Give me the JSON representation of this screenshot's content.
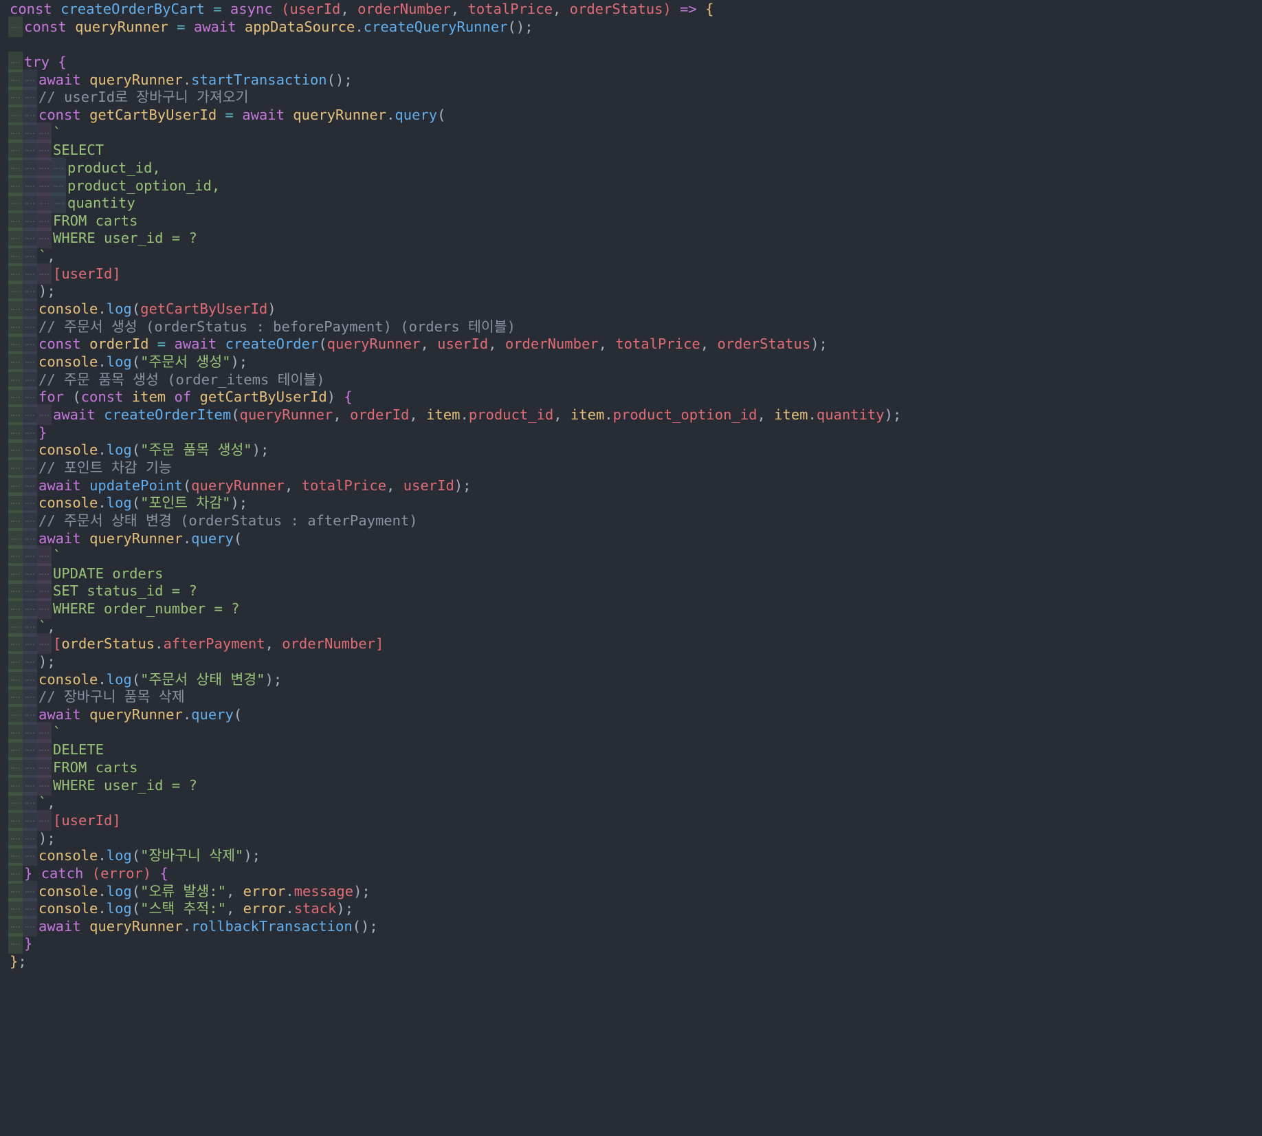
{
  "lines": [
    {
      "indent": 0,
      "tokens": [
        [
          "k",
          "const "
        ],
        [
          "f",
          "createOrderByCart"
        ],
        [
          "o",
          " = "
        ],
        [
          "k",
          "async "
        ],
        [
          "p",
          "("
        ],
        [
          "p",
          "userId"
        ],
        [
          "t",
          ", "
        ],
        [
          "p",
          "orderNumber"
        ],
        [
          "t",
          ", "
        ],
        [
          "p",
          "totalPrice"
        ],
        [
          "t",
          ", "
        ],
        [
          "p",
          "orderStatus"
        ],
        [
          "p",
          ")"
        ],
        [
          "k",
          " => "
        ],
        [
          "v",
          "{"
        ]
      ]
    },
    {
      "indent": 1,
      "tokens": [
        [
          "k",
          "const "
        ],
        [
          "v",
          "queryRunner"
        ],
        [
          "o",
          " = "
        ],
        [
          "k",
          "await "
        ],
        [
          "v",
          "appDataSource"
        ],
        [
          "t",
          "."
        ],
        [
          "f",
          "createQueryRunner"
        ],
        [
          "t",
          "();"
        ]
      ]
    },
    {
      "indent": 0,
      "tokens": []
    },
    {
      "indent": 1,
      "tokens": [
        [
          "k",
          "try "
        ],
        [
          "k",
          "{"
        ]
      ]
    },
    {
      "indent": 2,
      "tokens": [
        [
          "k",
          "await "
        ],
        [
          "v",
          "queryRunner"
        ],
        [
          "t",
          "."
        ],
        [
          "f",
          "startTransaction"
        ],
        [
          "t",
          "();"
        ]
      ]
    },
    {
      "indent": 2,
      "tokens": [
        [
          "c",
          "// userId로 장바구니 가져오기"
        ]
      ]
    },
    {
      "indent": 2,
      "tokens": [
        [
          "k",
          "const "
        ],
        [
          "v",
          "getCartByUserId"
        ],
        [
          "o",
          " = "
        ],
        [
          "k",
          "await "
        ],
        [
          "v",
          "queryRunner"
        ],
        [
          "t",
          "."
        ],
        [
          "f",
          "query"
        ],
        [
          "t",
          "("
        ]
      ]
    },
    {
      "indent": 3,
      "tokens": [
        [
          "s",
          "`"
        ]
      ]
    },
    {
      "indent": 3,
      "tokens": [
        [
          "s",
          "SELECT"
        ]
      ]
    },
    {
      "indent": 4,
      "tokens": [
        [
          "s",
          "product_id,"
        ]
      ]
    },
    {
      "indent": 4,
      "tokens": [
        [
          "s",
          "product_option_id,"
        ]
      ]
    },
    {
      "indent": 4,
      "tokens": [
        [
          "s",
          "quantity"
        ]
      ]
    },
    {
      "indent": 3,
      "tokens": [
        [
          "s",
          "FROM carts"
        ]
      ]
    },
    {
      "indent": 3,
      "tokens": [
        [
          "s",
          "WHERE user_id = ?"
        ]
      ]
    },
    {
      "indent": 2,
      "tokens": [
        [
          "s",
          "`"
        ],
        [
          "t",
          ","
        ]
      ]
    },
    {
      "indent": 3,
      "tokens": [
        [
          "p",
          "[userId]"
        ]
      ]
    },
    {
      "indent": 2,
      "tokens": [
        [
          "t",
          ");"
        ]
      ]
    },
    {
      "indent": 2,
      "tokens": [
        [
          "v",
          "console"
        ],
        [
          "t",
          "."
        ],
        [
          "f",
          "log"
        ],
        [
          "t",
          "("
        ],
        [
          "p",
          "getCartByUserId"
        ],
        [
          "t",
          ")"
        ]
      ]
    },
    {
      "indent": 2,
      "tokens": [
        [
          "c",
          "// 주문서 생성 (orderStatus : beforePayment) (orders 테이블)"
        ]
      ]
    },
    {
      "indent": 2,
      "tokens": [
        [
          "k",
          "const "
        ],
        [
          "v",
          "orderId"
        ],
        [
          "o",
          " = "
        ],
        [
          "k",
          "await "
        ],
        [
          "f",
          "createOrder"
        ],
        [
          "t",
          "("
        ],
        [
          "p",
          "queryRunner"
        ],
        [
          "t",
          ", "
        ],
        [
          "p",
          "userId"
        ],
        [
          "t",
          ", "
        ],
        [
          "p",
          "orderNumber"
        ],
        [
          "t",
          ", "
        ],
        [
          "p",
          "totalPrice"
        ],
        [
          "t",
          ", "
        ],
        [
          "p",
          "orderStatus"
        ],
        [
          "t",
          ");"
        ]
      ]
    },
    {
      "indent": 2,
      "tokens": [
        [
          "v",
          "console"
        ],
        [
          "t",
          "."
        ],
        [
          "f",
          "log"
        ],
        [
          "t",
          "("
        ],
        [
          "s",
          "\"주문서 생성\""
        ],
        [
          "t",
          ");"
        ]
      ]
    },
    {
      "indent": 2,
      "tokens": [
        [
          "c",
          "// 주문 품목 생성 (order_items 테이블)"
        ]
      ]
    },
    {
      "indent": 2,
      "tokens": [
        [
          "k",
          "for "
        ],
        [
          "t",
          "("
        ],
        [
          "k",
          "const "
        ],
        [
          "v",
          "item"
        ],
        [
          "k",
          " of "
        ],
        [
          "v",
          "getCartByUserId"
        ],
        [
          "t",
          ") "
        ],
        [
          "k",
          "{"
        ]
      ]
    },
    {
      "indent": 3,
      "tokens": [
        [
          "k",
          "await "
        ],
        [
          "f",
          "createOrderItem"
        ],
        [
          "t",
          "("
        ],
        [
          "p",
          "queryRunner"
        ],
        [
          "t",
          ", "
        ],
        [
          "p",
          "orderId"
        ],
        [
          "t",
          ", "
        ],
        [
          "v",
          "item"
        ],
        [
          "t",
          "."
        ],
        [
          "p",
          "product_id"
        ],
        [
          "t",
          ", "
        ],
        [
          "v",
          "item"
        ],
        [
          "t",
          "."
        ],
        [
          "p",
          "product_option_id"
        ],
        [
          "t",
          ", "
        ],
        [
          "v",
          "item"
        ],
        [
          "t",
          "."
        ],
        [
          "p",
          "quantity"
        ],
        [
          "t",
          ");"
        ]
      ]
    },
    {
      "indent": 2,
      "tokens": [
        [
          "k",
          "}"
        ]
      ]
    },
    {
      "indent": 2,
      "tokens": [
        [
          "v",
          "console"
        ],
        [
          "t",
          "."
        ],
        [
          "f",
          "log"
        ],
        [
          "t",
          "("
        ],
        [
          "s",
          "\"주문 품목 생성\""
        ],
        [
          "t",
          ");"
        ]
      ]
    },
    {
      "indent": 2,
      "tokens": [
        [
          "c",
          "// 포인트 차감 기능"
        ]
      ]
    },
    {
      "indent": 2,
      "tokens": [
        [
          "k",
          "await "
        ],
        [
          "f",
          "updatePoint"
        ],
        [
          "t",
          "("
        ],
        [
          "p",
          "queryRunner"
        ],
        [
          "t",
          ", "
        ],
        [
          "p",
          "totalPrice"
        ],
        [
          "t",
          ", "
        ],
        [
          "p",
          "userId"
        ],
        [
          "t",
          ");"
        ]
      ]
    },
    {
      "indent": 2,
      "tokens": [
        [
          "v",
          "console"
        ],
        [
          "t",
          "."
        ],
        [
          "f",
          "log"
        ],
        [
          "t",
          "("
        ],
        [
          "s",
          "\"포인트 차감\""
        ],
        [
          "t",
          ");"
        ]
      ]
    },
    {
      "indent": 2,
      "tokens": [
        [
          "c",
          "// 주문서 상태 변경 (orderStatus : afterPayment)"
        ]
      ]
    },
    {
      "indent": 2,
      "tokens": [
        [
          "k",
          "await "
        ],
        [
          "v",
          "queryRunner"
        ],
        [
          "t",
          "."
        ],
        [
          "f",
          "query"
        ],
        [
          "t",
          "("
        ]
      ]
    },
    {
      "indent": 3,
      "tokens": [
        [
          "s",
          "`"
        ]
      ]
    },
    {
      "indent": 3,
      "tokens": [
        [
          "s",
          "UPDATE orders"
        ]
      ]
    },
    {
      "indent": 3,
      "tokens": [
        [
          "s",
          "SET status_id = ?"
        ]
      ]
    },
    {
      "indent": 3,
      "tokens": [
        [
          "s",
          "WHERE order_number = ?"
        ]
      ]
    },
    {
      "indent": 2,
      "tokens": [
        [
          "s",
          "`"
        ],
        [
          "t",
          ","
        ]
      ]
    },
    {
      "indent": 3,
      "tokens": [
        [
          "p",
          "["
        ],
        [
          "v",
          "orderStatus"
        ],
        [
          "t",
          "."
        ],
        [
          "p",
          "afterPayment"
        ],
        [
          "t",
          ", "
        ],
        [
          "p",
          "orderNumber"
        ],
        [
          "p",
          "]"
        ]
      ]
    },
    {
      "indent": 2,
      "tokens": [
        [
          "t",
          ");"
        ]
      ]
    },
    {
      "indent": 2,
      "tokens": [
        [
          "v",
          "console"
        ],
        [
          "t",
          "."
        ],
        [
          "f",
          "log"
        ],
        [
          "t",
          "("
        ],
        [
          "s",
          "\"주문서 상태 변경\""
        ],
        [
          "t",
          ");"
        ]
      ]
    },
    {
      "indent": 2,
      "tokens": [
        [
          "c",
          "// 장바구니 품목 삭제"
        ]
      ]
    },
    {
      "indent": 2,
      "tokens": [
        [
          "k",
          "await "
        ],
        [
          "v",
          "queryRunner"
        ],
        [
          "t",
          "."
        ],
        [
          "f",
          "query"
        ],
        [
          "t",
          "("
        ]
      ]
    },
    {
      "indent": 3,
      "tokens": [
        [
          "s",
          "`"
        ]
      ]
    },
    {
      "indent": 3,
      "tokens": [
        [
          "s",
          "DELETE"
        ]
      ]
    },
    {
      "indent": 3,
      "tokens": [
        [
          "s",
          "FROM carts"
        ]
      ]
    },
    {
      "indent": 3,
      "tokens": [
        [
          "s",
          "WHERE user_id = ?"
        ]
      ]
    },
    {
      "indent": 2,
      "tokens": [
        [
          "s",
          "`"
        ],
        [
          "t",
          ","
        ]
      ]
    },
    {
      "indent": 3,
      "tokens": [
        [
          "p",
          "[userId]"
        ]
      ]
    },
    {
      "indent": 2,
      "tokens": [
        [
          "t",
          ");"
        ]
      ]
    },
    {
      "indent": 2,
      "tokens": [
        [
          "v",
          "console"
        ],
        [
          "t",
          "."
        ],
        [
          "f",
          "log"
        ],
        [
          "t",
          "("
        ],
        [
          "s",
          "\"장바구니 삭제\""
        ],
        [
          "t",
          ");"
        ]
      ]
    },
    {
      "indent": 1,
      "tokens": [
        [
          "k",
          "} "
        ],
        [
          "k",
          "catch "
        ],
        [
          "p",
          "(error) "
        ],
        [
          "k",
          "{"
        ]
      ]
    },
    {
      "indent": 2,
      "tokens": [
        [
          "v",
          "console"
        ],
        [
          "t",
          "."
        ],
        [
          "f",
          "log"
        ],
        [
          "t",
          "("
        ],
        [
          "s",
          "\"오류 발생:\""
        ],
        [
          "t",
          ", "
        ],
        [
          "v",
          "error"
        ],
        [
          "t",
          "."
        ],
        [
          "p",
          "message"
        ],
        [
          "t",
          ");"
        ]
      ]
    },
    {
      "indent": 2,
      "tokens": [
        [
          "v",
          "console"
        ],
        [
          "t",
          "."
        ],
        [
          "f",
          "log"
        ],
        [
          "t",
          "("
        ],
        [
          "s",
          "\"스택 추적:\""
        ],
        [
          "t",
          ", "
        ],
        [
          "v",
          "error"
        ],
        [
          "t",
          "."
        ],
        [
          "p",
          "stack"
        ],
        [
          "t",
          ");"
        ]
      ]
    },
    {
      "indent": 2,
      "tokens": [
        [
          "k",
          "await "
        ],
        [
          "v",
          "queryRunner"
        ],
        [
          "t",
          "."
        ],
        [
          "f",
          "rollbackTransaction"
        ],
        [
          "t",
          "();"
        ]
      ]
    },
    {
      "indent": 1,
      "tokens": [
        [
          "k",
          "}"
        ]
      ]
    },
    {
      "indent": 0,
      "tokens": [
        [
          "v",
          "}"
        ],
        [
          "t",
          ";"
        ]
      ]
    }
  ],
  "colors": {
    "background": "#282c34",
    "keyword": "#c678dd",
    "function": "#61afef",
    "variable": "#e5c07b",
    "parameter": "#e06c75",
    "string": "#98c379",
    "comment": "#8a93a3",
    "operator": "#56b6c2",
    "text": "#abb2bf"
  }
}
